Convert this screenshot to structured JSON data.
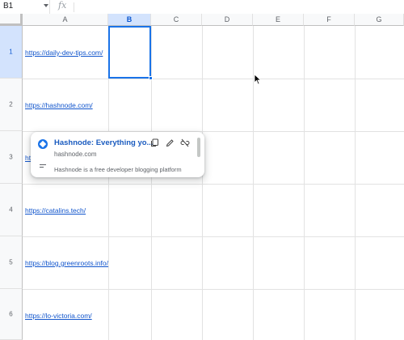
{
  "formula_bar": {
    "name_box": "B1",
    "fx_label": "fx",
    "formula_value": ""
  },
  "columns": [
    "A",
    "B",
    "C",
    "D",
    "E",
    "F",
    "G"
  ],
  "selected_column": "B",
  "rows": [
    "1",
    "2",
    "3",
    "4",
    "5",
    "6"
  ],
  "selected_row": "1",
  "cells": {
    "a1": "https://daily-dev-tips.com/",
    "a2": "https://hashnode.com/",
    "a3_visible": "ht",
    "a4": "https://catalins.tech/",
    "a5": "https://blog.greenroots.info/",
    "a6": "https://lo-victoria.com/"
  },
  "link_preview": {
    "title": "Hashnode: Everything yo...",
    "domain": "hashnode.com",
    "description": "Hashnode is a free developer blogging platform",
    "icons": [
      "copy-link-icon",
      "edit-link-icon",
      "remove-link-icon"
    ]
  },
  "colors": {
    "link": "#1155cc",
    "selection": "#1a73e8",
    "header_selected": "#d3e3fd"
  }
}
